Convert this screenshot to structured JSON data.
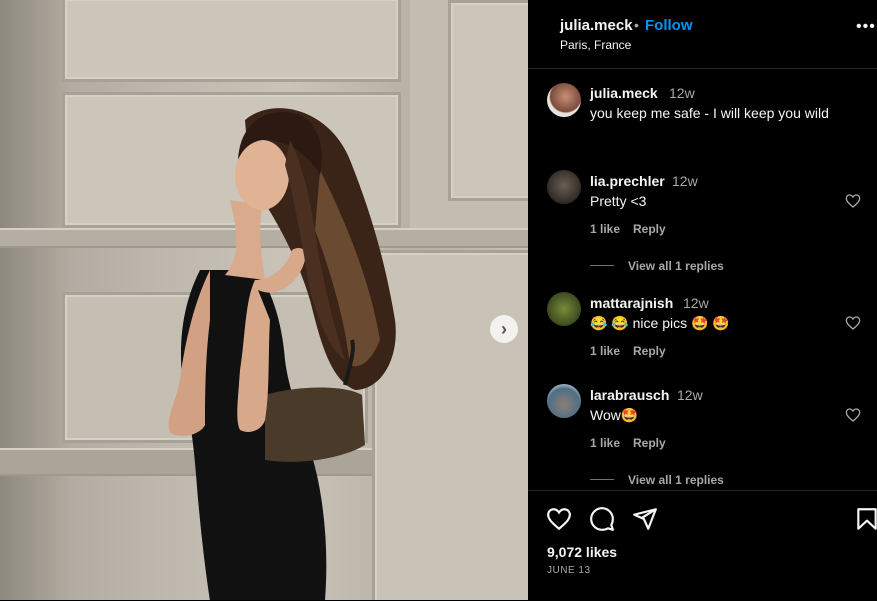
{
  "post": {
    "username": "julia.meck",
    "follow_label": "Follow",
    "separator": "•",
    "location": "Paris, France",
    "more_label": "•••"
  },
  "caption": {
    "username": "julia.meck",
    "ago": "12w",
    "text": "you keep me safe - I will keep you wild"
  },
  "comments": [
    {
      "username": "lia.prechler",
      "ago": "12w",
      "text": "Pretty <3",
      "likes": "1 like",
      "reply": "Reply",
      "view_replies": "View all 1 replies"
    },
    {
      "username": "mattarajnish",
      "ago": "12w",
      "text": "😂 😂  nice pics  🤩 🤩",
      "likes": "1 like",
      "reply": "Reply"
    },
    {
      "username": "larabrausch",
      "ago": "12w",
      "text": "Wow🤩",
      "likes": "1 like",
      "reply": "Reply",
      "view_replies": "View all 1 replies"
    }
  ],
  "footer": {
    "likes": "9,072 likes",
    "date": "JUNE 13"
  },
  "carousel": {
    "next_label": "›"
  },
  "colors": {
    "follow": "#0095f6",
    "muted": "#a8a8a8",
    "background": "#000000"
  },
  "icons": [
    "heart-icon",
    "comment-icon",
    "share-icon",
    "bookmark-icon",
    "more-icon",
    "chevron-right-icon"
  ]
}
